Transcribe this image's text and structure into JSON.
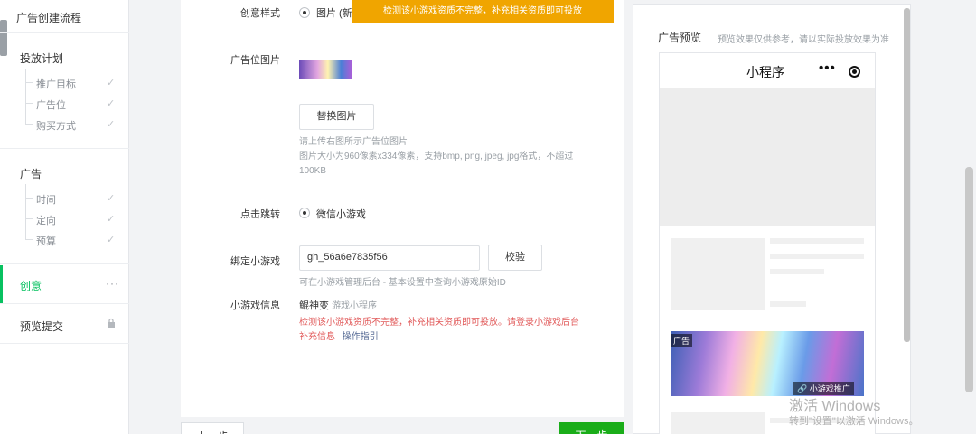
{
  "sidebar": {
    "title": "广告创建流程",
    "groups": [
      {
        "label": "投放计划",
        "items": [
          {
            "label": "推广目标"
          },
          {
            "label": "广告位"
          },
          {
            "label": "购买方式"
          }
        ]
      },
      {
        "label": "广告",
        "items": [
          {
            "label": "时间"
          },
          {
            "label": "定向"
          },
          {
            "label": "预算"
          }
        ]
      }
    ],
    "creative": {
      "label": "创意",
      "more": "···"
    },
    "submit": {
      "label": "预览提交"
    }
  },
  "toast": "检测该小游戏资质不完整，补充相关资质即可投放",
  "form": {
    "style_label": "创意样式",
    "style_option": "图片 (新",
    "image_label": "广告位图片",
    "replace_button": "替换图片",
    "image_hint_1": "请上传右图所示广告位图片",
    "image_hint_2": "图片大小为960像素x334像素，支持bmp, png, jpeg, jpg格式，不超过",
    "image_hint_3": "100KB",
    "jump_label": "点击跳转",
    "jump_option": "微信小游戏",
    "bind_label": "绑定小游戏",
    "bind_value": "gh_56a6e7835f56",
    "verify_button": "校验",
    "bind_hint": "可在小游戏管理后台 - 基本设置中查询小游戏原始ID",
    "info_label": "小游戏信息",
    "info_name": "鲲神变",
    "info_type": "游戏小程序",
    "warn_1": "检测该小游戏资质不完整，补充相关资质即可投放。请登录小游戏后台",
    "warn_2": "补充信息",
    "warn_link": "操作指引"
  },
  "footer": {
    "prev": "上一步",
    "next": "下一步"
  },
  "preview": {
    "title": "广告预览",
    "note": "预览效果仅供参考，请以实际投放效果为准",
    "phone_title": "小程序",
    "phone_more": "•••",
    "ad_badge": "广告",
    "ad_tag": "🔗 小游戏推广"
  },
  "watermark": {
    "line1": "激活 Windows",
    "line2": "转到\"设置\"以激活 Windows。"
  },
  "colors": {
    "accent": "#07c160",
    "next_button": "#1aad19",
    "toast": "#f0a500",
    "warning": "#e15a5a",
    "link": "#576b95"
  }
}
